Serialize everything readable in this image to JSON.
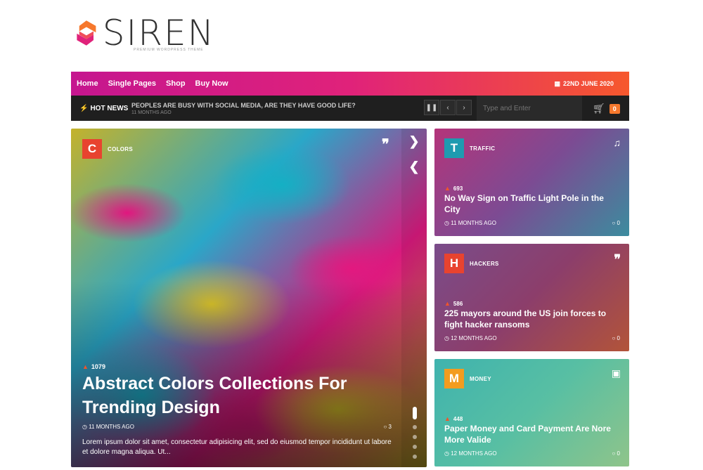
{
  "logo": {
    "text": "SIREN",
    "tagline": "PREMIUM WORDPRESS THEME",
    "colors": [
      "#f6782d",
      "#e0227a"
    ]
  },
  "nav": {
    "items": [
      "Home",
      "Single Pages",
      "Shop",
      "Buy Now"
    ],
    "date": "22ND JUNE 2020"
  },
  "hot": {
    "label": "HOT NEWS",
    "headline": "PEOPLES ARE BUSY WITH SOCIAL MEDIA, ARE THEY HAVE GOOD LIFE?",
    "time": "11 MONTHS AGO",
    "search_placeholder": "Type and Enter",
    "cart_count": "0"
  },
  "hero": {
    "category_letter": "C",
    "category": "COLORS",
    "views": "1079",
    "title": "Abstract Colors Collections For Trending Design",
    "time": "11 MONTHS AGO",
    "comments": "3",
    "excerpt": "Lorem ipsum dolor sit amet, consectetur adipisicing elit, sed do eiusmod tempor incididunt ut labore et dolore magna aliqua. Ut..."
  },
  "cards": [
    {
      "letter": "T",
      "letter_color": "#1e9bb0",
      "category": "TRAFFIC",
      "views": "693",
      "title": "No Way Sign on Traffic Light Pole in the City",
      "time": "11 MONTHS AGO",
      "comments": "0",
      "icon": "music-note-icon"
    },
    {
      "letter": "H",
      "letter_color": "#e8432f",
      "category": "HACKERS",
      "views": "586",
      "title": "225 mayors around the US join forces to fight hacker ransoms",
      "time": "12 MONTHS AGO",
      "comments": "0",
      "icon": "quote-icon"
    },
    {
      "letter": "M",
      "letter_color": "#f39c1f",
      "category": "MONEY",
      "views": "448",
      "title": "Paper Money and Card Payment Are Nore More Valide",
      "time": "12 MONTHS AGO",
      "comments": "0",
      "icon": "image-icon"
    }
  ]
}
